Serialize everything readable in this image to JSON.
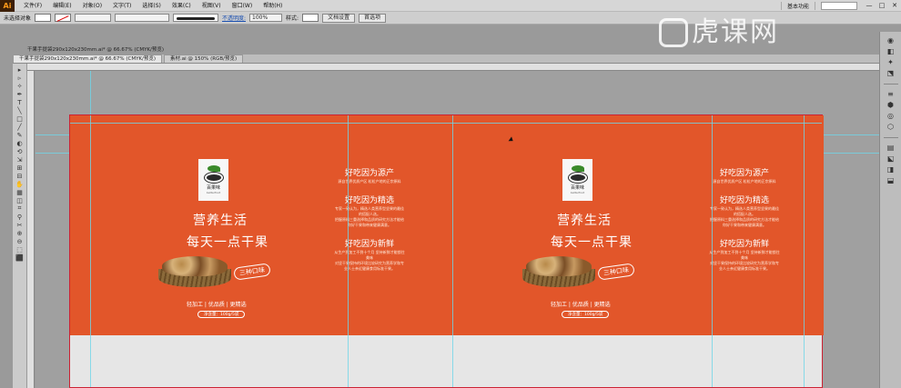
{
  "app": {
    "logo": "Ai"
  },
  "menubar": {
    "items": [
      "文件(F)",
      "编辑(E)",
      "对象(O)",
      "文字(T)",
      "选择(S)",
      "效果(C)",
      "视图(V)",
      "窗口(W)",
      "帮助(H)"
    ],
    "workspace": "基本功能",
    "controls": [
      "—",
      "□",
      "✕"
    ]
  },
  "controlbar": {
    "selection": "未选择对象",
    "opacity_label": "不透明度:",
    "opacity_value": "100%",
    "style_label": "样式:",
    "doc_setup": "文档设置",
    "preferences": "首选项"
  },
  "document": {
    "title": "干果手提袋290x120x230mm.ai* @ 66.67% (CMYK/预览)",
    "tabs": [
      "干果手提袋290x120x230mm.ai* @ 66.67% (CMYK/预览)",
      "素材.ai @ 150% (RGB/预览)"
    ]
  },
  "watermark": {
    "text": "虎课网"
  },
  "colors": {
    "bag_orange": "#e2562a",
    "guide": "#6fd6e8"
  },
  "design": {
    "brand_name": "百果味",
    "brand_sub": "bettarfruit",
    "slogan_1": "营养生活",
    "slogan_2": "每天一点干果",
    "badge": "三种口味",
    "features": "轻加工 | 优品质 | 更精选",
    "net_weight": "净含量：100g/5袋",
    "blocks": [
      {
        "h": "好吃因为源产",
        "p": "源自世界优质产区 粒粒产地的正宗原料"
      },
      {
        "h": "好吃因为精选",
        "p": "专家一致认为，精选人类营养型坚果的最佳的搭配人选。"
      },
      {
        "h": "好吃因为新鲜",
        "p": "从生产到加工不到十个月 坚持新鲜才能锁住美味"
      }
    ],
    "body_2": "把握原料三重选择和品质的研究方法才能给你好干果和带来健康满意。",
    "body_3": "对坚干果保持的环境比较研究为营养学和专业人士亲近健康食用标准干果。"
  },
  "tools": [
    "▸",
    "▹",
    "✧",
    "✒",
    "T",
    "╲",
    "□",
    "╱",
    "✎",
    "◐",
    "⟲",
    "⇲",
    "⊞",
    "⊟",
    "✋",
    "▦",
    "◫",
    "⌗",
    "⚲",
    "✂",
    "⊕",
    "⊖",
    "⬚",
    "⬛"
  ],
  "right_panel_icons": [
    "◉",
    "◧",
    "✦",
    "⬔",
    "≡",
    "⬢",
    "◎",
    "⬡",
    "▤",
    "⬕",
    "◨",
    "⬓"
  ]
}
